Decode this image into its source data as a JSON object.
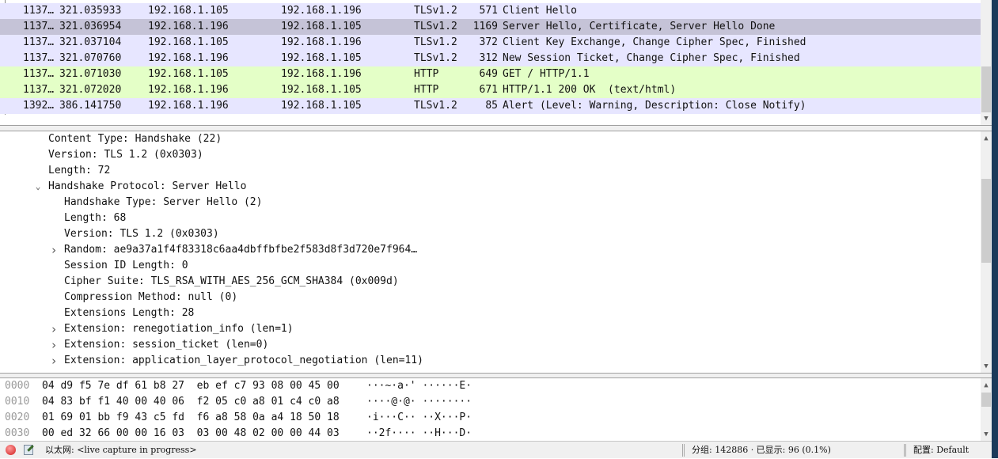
{
  "packet_list": {
    "rows": [
      {
        "no": "1137…",
        "time": "321.035933",
        "src": "192.168.1.105",
        "dst": "192.168.1.196",
        "proto": "TLSv1.2",
        "len": "571",
        "info": "Client Hello",
        "bg": "#e7e6ff"
      },
      {
        "no": "1137…",
        "time": "321.036954",
        "src": "192.168.1.196",
        "dst": "192.168.1.105",
        "proto": "TLSv1.2",
        "len": "1169",
        "info": "Server Hello, Certificate, Server Hello Done",
        "bg": "#c5c3d7",
        "selected": true
      },
      {
        "no": "1137…",
        "time": "321.037104",
        "src": "192.168.1.105",
        "dst": "192.168.1.196",
        "proto": "TLSv1.2",
        "len": "372",
        "info": "Client Key Exchange, Change Cipher Spec, Finished",
        "bg": "#e7e6ff"
      },
      {
        "no": "1137…",
        "time": "321.070760",
        "src": "192.168.1.196",
        "dst": "192.168.1.105",
        "proto": "TLSv1.2",
        "len": "312",
        "info": "New Session Ticket, Change Cipher Spec, Finished",
        "bg": "#e7e6ff"
      },
      {
        "no": "1137…",
        "time": "321.071030",
        "src": "192.168.1.105",
        "dst": "192.168.1.196",
        "proto": "HTTP",
        "len": "649",
        "info": "GET / HTTP/1.1",
        "bg": "#e4ffc7"
      },
      {
        "no": "1137…",
        "time": "321.072020",
        "src": "192.168.1.196",
        "dst": "192.168.1.105",
        "proto": "HTTP",
        "len": "671",
        "info": "HTTP/1.1 200 OK  (text/html)",
        "bg": "#e4ffc7"
      },
      {
        "no": "1392…",
        "time": "386.141750",
        "src": "192.168.1.196",
        "dst": "192.168.1.105",
        "proto": "TLSv1.2",
        "len": "85",
        "info": "Alert (Level: Warning, Description: Close Notify)",
        "bg": "#e7e6ff"
      }
    ]
  },
  "details": {
    "lines": [
      {
        "text": "Content Type: Handshake (22)",
        "level": 1
      },
      {
        "text": "Version: TLS 1.2 (0x0303)",
        "level": 1
      },
      {
        "text": "Length: 72",
        "level": 1
      },
      {
        "text": "Handshake Protocol: Server Hello",
        "level": 1,
        "toggle": "expanded"
      },
      {
        "text": "Handshake Type: Server Hello (2)",
        "level": 2
      },
      {
        "text": "Length: 68",
        "level": 2
      },
      {
        "text": "Version: TLS 1.2 (0x0303)",
        "level": 2
      },
      {
        "text": "Random: ae9a37a1f4f83318c6aa4dbffbfbe2f583d8f3d720e7f964…",
        "level": 2,
        "toggle": "collapsed"
      },
      {
        "text": "Session ID Length: 0",
        "level": 2
      },
      {
        "text": "Cipher Suite: TLS_RSA_WITH_AES_256_GCM_SHA384 (0x009d)",
        "level": 2
      },
      {
        "text": "Compression Method: null (0)",
        "level": 2
      },
      {
        "text": "Extensions Length: 28",
        "level": 2
      },
      {
        "text": "Extension: renegotiation_info (len=1)",
        "level": 2,
        "toggle": "collapsed"
      },
      {
        "text": "Extension: session_ticket (len=0)",
        "level": 2,
        "toggle": "collapsed"
      },
      {
        "text": "Extension: application_layer_protocol_negotiation (len=11)",
        "level": 2,
        "toggle": "collapsed"
      }
    ]
  },
  "hex": {
    "lines": [
      {
        "offset": "0000",
        "bytes": "04 d9 f5 7e df 61 b8 27  eb ef c7 93 08 00 45 00",
        "ascii": "···~·a·' ······E·"
      },
      {
        "offset": "0010",
        "bytes": "04 83 bf f1 40 00 40 06  f2 05 c0 a8 01 c4 c0 a8",
        "ascii": "····@·@· ········"
      },
      {
        "offset": "0020",
        "bytes": "01 69 01 bb f9 43 c5 fd  f6 a8 58 0a a4 18 50 18",
        "ascii": "·i···C·· ··X···P·"
      },
      {
        "offset": "0030",
        "bytes": "00 ed 32 66 00 00 16 03  03 00 48 02 00 00 44 03",
        "ascii": "··2f···· ··H···D·"
      }
    ]
  },
  "status": {
    "interface": "以太网: <live capture in progress>",
    "packets": "分组: 142886 · 已显示: 96 (0.1%)",
    "profile": "配置: Default",
    "capture_icon_color": "#e04040"
  }
}
